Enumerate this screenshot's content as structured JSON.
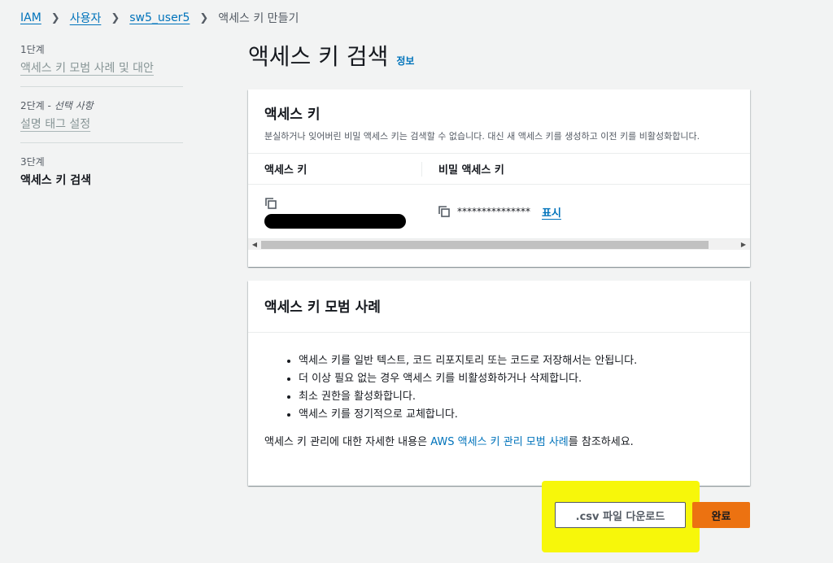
{
  "breadcrumb": {
    "items": [
      "IAM",
      "사용자",
      "sw5_user5"
    ],
    "current": "액세스 키 만들기"
  },
  "steps": [
    {
      "num": "1단계",
      "optional": "",
      "label": "액세스 키 모범 사례 및 대안"
    },
    {
      "num": "2단계 -",
      "optional": "선택 사항",
      "label": "설명 태그 설정"
    },
    {
      "num": "3단계",
      "optional": "",
      "label": "액세스 키 검색"
    }
  ],
  "page": {
    "title": "액세스 키 검색",
    "info": "정보"
  },
  "access_key_panel": {
    "title": "액세스 키",
    "description": "분실하거나 잊어버린 비밀 액세스 키는 검색할 수 없습니다. 대신 새 액세스 키를 생성하고 이전 키를 비활성화합니다.",
    "col_access_key": "액세스 키",
    "col_secret_key": "비밀 액세스 키",
    "secret_masked": "***************",
    "show_label": "표시"
  },
  "best_practices": {
    "title": "액세스 키 모범 사례",
    "items": [
      "액세스 키를 일반 텍스트, 코드 리포지토리 또는 코드로 저장해서는 안됩니다.",
      "더 이상 필요 없는 경우 액세스 키를 비활성화하거나 삭제합니다.",
      "최소 권한을 활성화합니다.",
      "액세스 키를 정기적으로 교체합니다."
    ],
    "note_prefix": "액세스 키 관리에 대한 자세한 내용은 ",
    "note_link": "AWS 액세스 키 관리 모범 사례",
    "note_suffix": "를 참조하세요."
  },
  "buttons": {
    "download_csv": ".csv 파일 다운로드",
    "done": "완료"
  },
  "colors": {
    "link": "#0073bb",
    "primary": "#ec7211",
    "highlight": "#f7f70a"
  }
}
